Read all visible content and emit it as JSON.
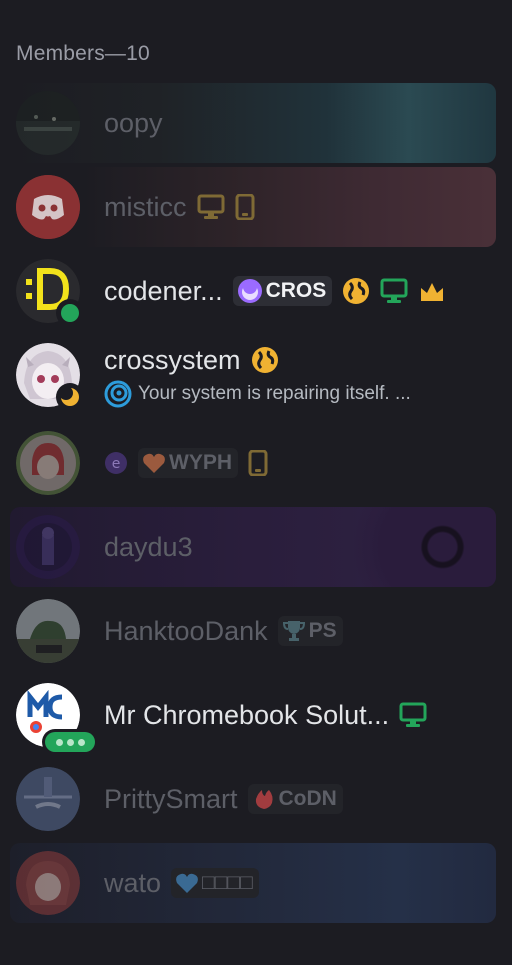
{
  "header": {
    "title": "Members—10"
  },
  "members": [
    {
      "name": "oopy"
    },
    {
      "name": "misticc"
    },
    {
      "name": "codener...",
      "tag": "CROS"
    },
    {
      "name": "crossystem",
      "activity": "Your system is repairing itself. ..."
    },
    {
      "name": "",
      "tag": "WYPH"
    },
    {
      "name": "daydu3"
    },
    {
      "name": "HanktooDank",
      "tag": "PS"
    },
    {
      "name": "Mr Chromebook Solut..."
    },
    {
      "name": "PrittySmart",
      "tag": "CoDN"
    },
    {
      "name": "wato",
      "tag": "□□□□"
    }
  ],
  "colors": {
    "background": "#1c1c22",
    "online": "#23a55a",
    "idle": "#f0b232",
    "desktop": "#23a55a",
    "owner_crown": "#f0b232",
    "discord_red": "#a8373a"
  },
  "icons": [
    "desktop-icon",
    "mobile-icon",
    "globe-icon",
    "crown-icon",
    "moon-icon",
    "trophy-icon",
    "heart-icon"
  ]
}
